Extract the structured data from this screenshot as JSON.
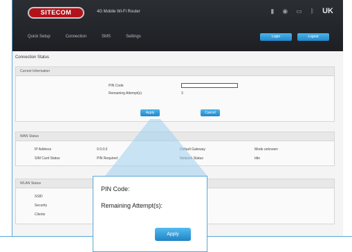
{
  "header": {
    "logo": "SITECOM",
    "product": "4G Mobile Wi-Fi Router",
    "lang": "UK",
    "nav": [
      "Quick Setup",
      "Connection",
      "SMS",
      "Settings"
    ],
    "btn1": "Login",
    "btn2": "Logout"
  },
  "page": {
    "title": "Connection Status",
    "current_panel": "Current Information",
    "pin_label": "PIN Code",
    "remaining_label": "Remaining Attempt(s)",
    "remaining_value": "3",
    "apply_label": "Apply",
    "cancel_label": "Cancel",
    "wan_panel": "WAN Status",
    "ip_label": "IP Address",
    "ip_value": "0.0.0.0",
    "sim_label": "SIM Card Status",
    "sim_value": "PIN Required",
    "gw_label": "Default Gateway",
    "gw_value": "Mode unknown",
    "dns_label": "Network Status",
    "dns_value": "Idle",
    "wlan_panel": "WLAN Status",
    "ssid_label": "SSID",
    "security_label": "Security",
    "clients_label": "Clients"
  },
  "zoom": {
    "pin_label": "PIN Code:",
    "remaining_label": "Remaining Attempt(s):",
    "apply_label": "Apply"
  }
}
